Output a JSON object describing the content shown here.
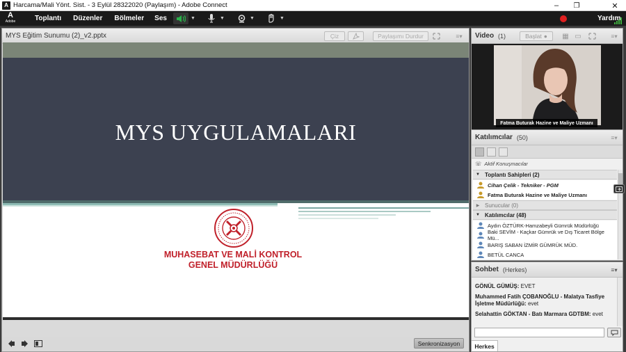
{
  "window": {
    "title": "Harcama/Mali Yönt. Sist. - 3 Eylül 28322020 (Paylaşım) - Adobe Connect",
    "app_icon": "A",
    "controls": [
      "–",
      "❐",
      "✕"
    ]
  },
  "menubar": {
    "logo": "A",
    "logo_sub": "Adobe",
    "items": [
      "Toplantı",
      "Düzenler",
      "Bölmeler",
      "Ses"
    ],
    "help": "Yardım",
    "icons": [
      "speaker-icon",
      "microphone-icon",
      "webcam-icon",
      "raise-hand-icon",
      "record-indicator-icon",
      "connection-bars-icon"
    ],
    "colors": {
      "speaker_active": "#29b14a",
      "record": "#e02020",
      "connection": "#3fae3f"
    }
  },
  "share_pod": {
    "title": "MYS Eğitim Sunumu (2)_v2.pptx",
    "draw_label": "Çiz",
    "stop_share_label": "Paylaşımı Durdur",
    "slide": {
      "title": "MYS UYGULAMALARI",
      "org_line1": "MUHASEBAT VE MALİ KONTROL",
      "org_line2": "GENEL MÜDÜRLÜĞÜ"
    },
    "sync_label": "Senkronizasyon"
  },
  "video_pod": {
    "title": "Video",
    "count": "(1)",
    "start_label": "Başlat",
    "caption": "Fatma Buturak Hazine ve Maliye Uzmanı"
  },
  "attendees_pod": {
    "title": "Katılımcılar",
    "count": "(50)",
    "active_speakers": "Aktif Konuşmacılar",
    "hosts_header": "Toplantı Sahipleri (2)",
    "hosts": [
      "Cihan Çelik - Tekniker - PGM",
      "Fatma Buturak Hazine ve Maliye Uzmanı"
    ],
    "presenters_header": "Sunucular (0)",
    "participants_header": "Katılımcılar (48)",
    "participants": [
      "Aydın ÖZTÜRK-Hamzabeyli Gümrük Müdürlüğü",
      "Baki SEVİM - Kaçkar Gümrük ve Dış Ticaret Bölge Mü...",
      "BARIŞ SABAN İZMİR GÜMRÜK MÜD.",
      "BETÜL CANCA"
    ]
  },
  "chat_pod": {
    "title": "Sohbet",
    "scope": "(Herkes)",
    "messages": [
      {
        "sender": "GÖNÜL GÜMÜŞ:",
        "text": " EVET"
      },
      {
        "sender": "Muhammed Fatih ÇOBANOĞLU - Malatya Tasfiye İşletme Müdürlüğü:",
        "text": " evet"
      },
      {
        "sender": "Selahattin GÖKTAN - Batı Marmara GDTBM:",
        "text": " evet"
      }
    ],
    "input_placeholder": "",
    "tab": "Herkes"
  }
}
